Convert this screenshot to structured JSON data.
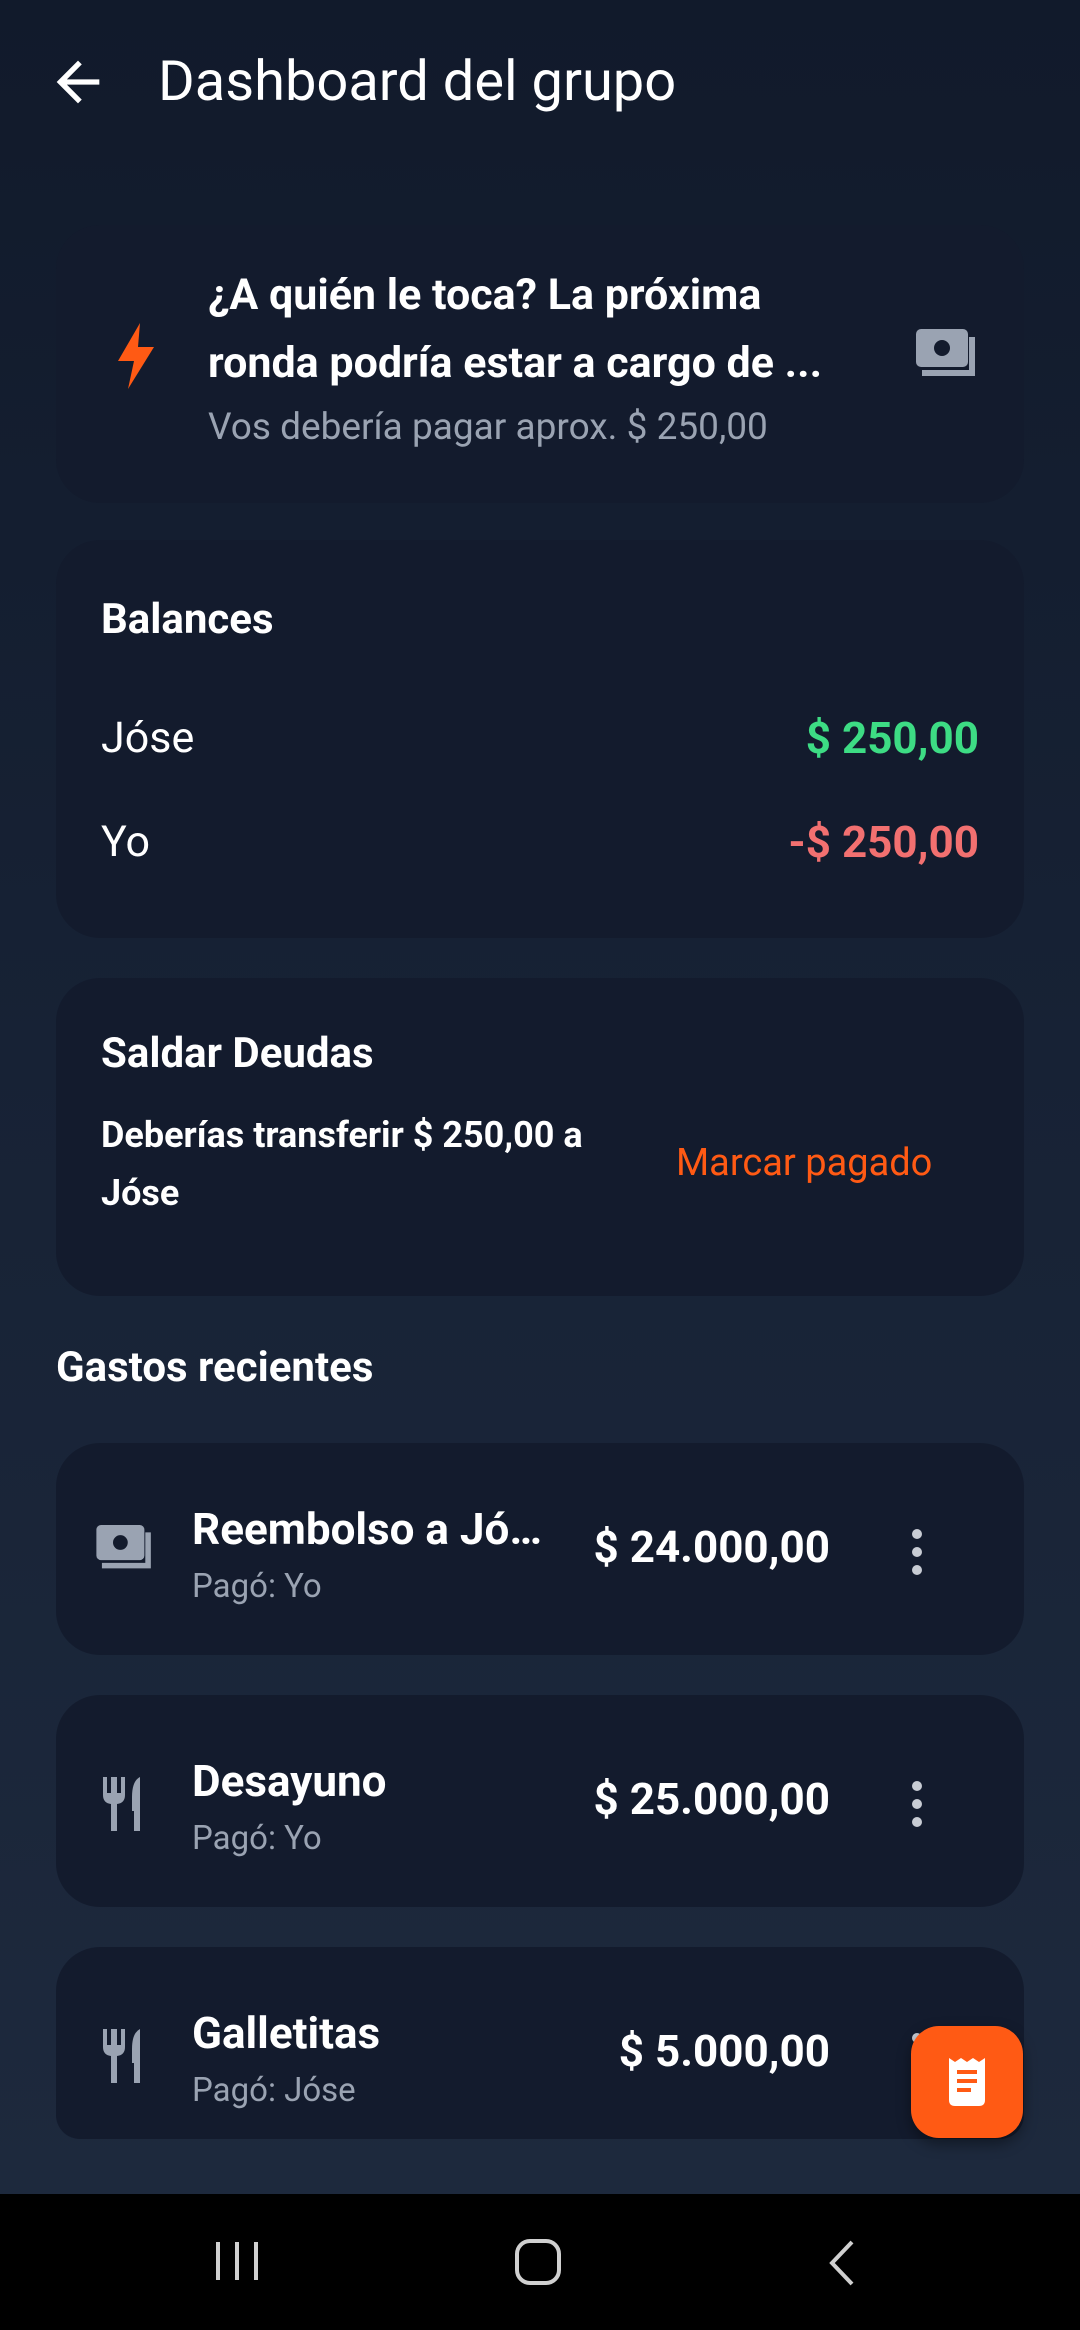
{
  "header": {
    "title": "Dashboard del grupo"
  },
  "turn_card": {
    "title_line1": "¿A quién le toca? La próxima",
    "title_line2": "ronda podría estar a cargo de ...",
    "subtitle": "Vos debería pagar aprox. $ 250,00",
    "accent_color": "#ff5a14"
  },
  "balances": {
    "title": "Balances",
    "rows": [
      {
        "name": "Jóse",
        "amount": "$ 250,00",
        "color": "#3ddc84"
      },
      {
        "name": "Yo",
        "amount": "-$ 250,00",
        "color": "#f27070"
      }
    ]
  },
  "settle": {
    "title": "Saldar Deudas",
    "line1": "Deberías transferir $ 250,00 a",
    "line2": "Jóse",
    "action": "Marcar pagado"
  },
  "recent": {
    "title": "Gastos recientes",
    "items": [
      {
        "icon": "money-icon",
        "name": "Reembolso a Jó…",
        "payer": "Pagó: Yo",
        "amount": "$ 24.000,00"
      },
      {
        "icon": "utensils-icon",
        "name": "Desayuno",
        "payer": "Pagó: Yo",
        "amount": "$ 25.000,00"
      },
      {
        "icon": "utensils-icon",
        "name": "Galletitas",
        "payer": "Pagó: Jóse",
        "amount": "$ 5.000,00"
      }
    ]
  },
  "fab": {
    "icon": "receipt-icon"
  },
  "navbar": {
    "buttons": [
      "recent-apps",
      "home",
      "back"
    ]
  }
}
